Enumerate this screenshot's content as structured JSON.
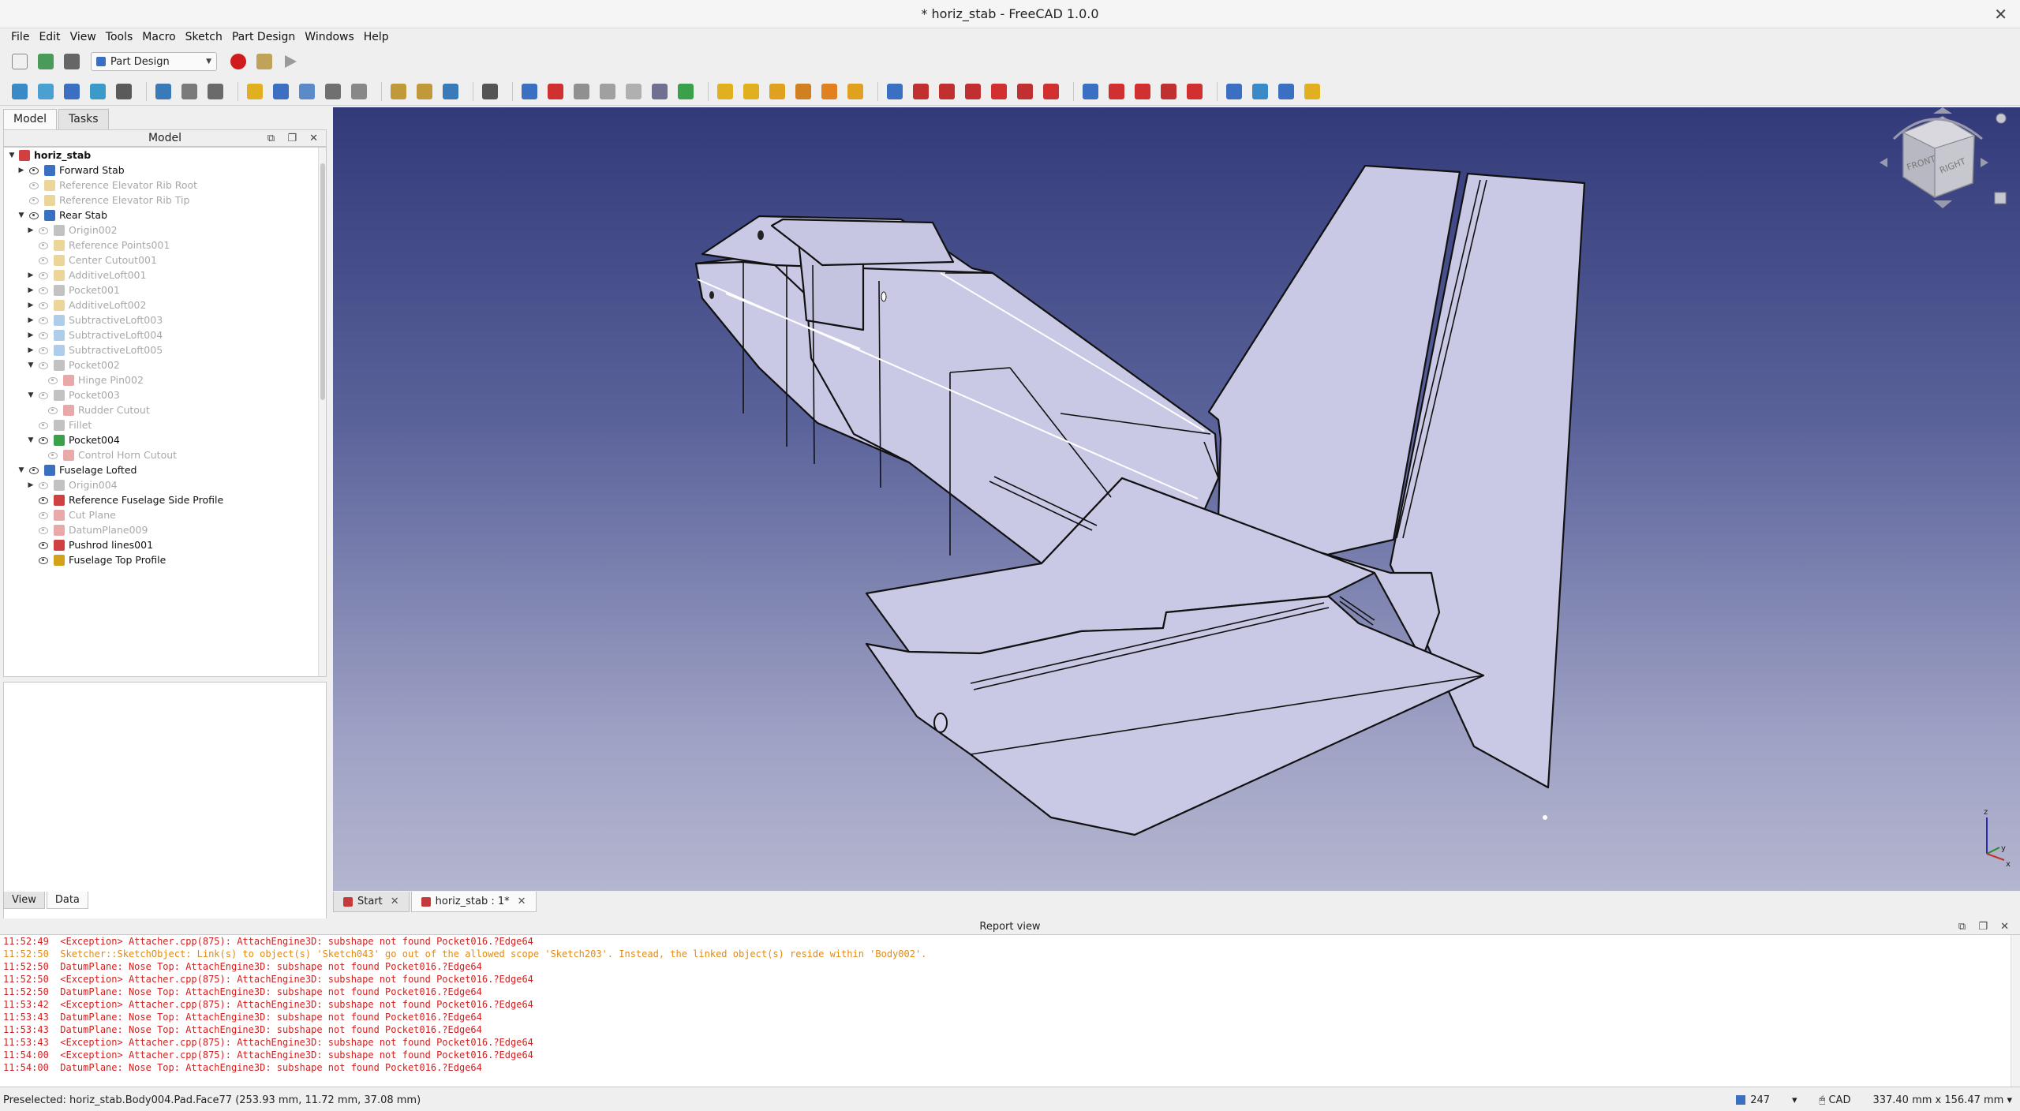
{
  "window": {
    "title": "* horiz_stab - FreeCAD 1.0.0"
  },
  "menu": [
    "File",
    "Edit",
    "View",
    "Tools",
    "Macro",
    "Sketch",
    "Part Design",
    "Windows",
    "Help"
  ],
  "workbench": {
    "selected": "Part Design"
  },
  "combo": {
    "tabs": [
      "Model",
      "Tasks"
    ],
    "tree_header": "Model",
    "property_tabs": [
      "View",
      "Data"
    ]
  },
  "tree": [
    {
      "label": "horiz_stab",
      "level": 0,
      "expand": "down",
      "eye": false,
      "state": "bold",
      "color": "#d04040"
    },
    {
      "label": "Forward Stab",
      "level": 1,
      "expand": "right",
      "eye": true,
      "state": "normal",
      "color": "#3a6fc2"
    },
    {
      "label": "Reference Elevator Rib Root",
      "level": 1,
      "expand": "",
      "eye": "hidden",
      "state": "dim",
      "color": "#d4a21a"
    },
    {
      "label": "Reference Elevator Rib Tip",
      "level": 1,
      "expand": "",
      "eye": "hidden",
      "state": "dim",
      "color": "#d4a21a"
    },
    {
      "label": "Rear Stab",
      "level": 1,
      "expand": "down",
      "eye": true,
      "state": "normal",
      "color": "#3a6fc2"
    },
    {
      "label": "Origin002",
      "level": 2,
      "expand": "right",
      "eye": "hidden",
      "state": "dim",
      "color": "#777777"
    },
    {
      "label": "Reference Points001",
      "level": 2,
      "expand": "",
      "eye": "hidden",
      "state": "dim",
      "color": "#d4a21a"
    },
    {
      "label": "Center Cutout001",
      "level": 2,
      "expand": "",
      "eye": "hidden",
      "state": "dim",
      "color": "#d4a21a"
    },
    {
      "label": "AdditiveLoft001",
      "level": 2,
      "expand": "right",
      "eye": "hidden",
      "state": "dim",
      "color": "#d4a21a"
    },
    {
      "label": "Pocket001",
      "level": 2,
      "expand": "right",
      "eye": "hidden",
      "state": "dim",
      "color": "#777777"
    },
    {
      "label": "AdditiveLoft002",
      "level": 2,
      "expand": "right",
      "eye": "hidden",
      "state": "dim",
      "color": "#d4a21a"
    },
    {
      "label": "SubtractiveLoft003",
      "level": 2,
      "expand": "right",
      "eye": "hidden",
      "state": "dim",
      "color": "#4a90d0"
    },
    {
      "label": "SubtractiveLoft004",
      "level": 2,
      "expand": "right",
      "eye": "hidden",
      "state": "dim",
      "color": "#4a90d0"
    },
    {
      "label": "SubtractiveLoft005",
      "level": 2,
      "expand": "right",
      "eye": "hidden",
      "state": "dim",
      "color": "#4a90d0"
    },
    {
      "label": "Pocket002",
      "level": 2,
      "expand": "down",
      "eye": "hidden",
      "state": "dim",
      "color": "#777777"
    },
    {
      "label": "Hinge Pin002",
      "level": 3,
      "expand": "",
      "eye": "hidden",
      "state": "dim",
      "color": "#d04040"
    },
    {
      "label": "Pocket003",
      "level": 2,
      "expand": "down",
      "eye": "hidden",
      "state": "dim",
      "color": "#777777"
    },
    {
      "label": "Rudder Cutout",
      "level": 3,
      "expand": "",
      "eye": "hidden",
      "state": "dim",
      "color": "#d04040"
    },
    {
      "label": "Fillet",
      "level": 2,
      "expand": "",
      "eye": "hidden",
      "state": "dim",
      "color": "#777777"
    },
    {
      "label": "Pocket004",
      "level": 2,
      "expand": "down",
      "eye": true,
      "state": "normal",
      "color": "#3aa04a"
    },
    {
      "label": "Control Horn Cutout",
      "level": 3,
      "expand": "",
      "eye": "hidden",
      "state": "dim",
      "color": "#d04040"
    },
    {
      "label": "Fuselage Lofted",
      "level": 1,
      "expand": "down",
      "eye": true,
      "state": "normal",
      "color": "#3a6fc2"
    },
    {
      "label": "Origin004",
      "level": 2,
      "expand": "right",
      "eye": "hidden",
      "state": "dim",
      "color": "#777777"
    },
    {
      "label": "Reference Fuselage Side Profile",
      "level": 2,
      "expand": "",
      "eye": true,
      "state": "normal",
      "color": "#d04040"
    },
    {
      "label": "Cut Plane",
      "level": 2,
      "expand": "",
      "eye": "hidden",
      "state": "dim",
      "color": "#d04040"
    },
    {
      "label": "DatumPlane009",
      "level": 2,
      "expand": "",
      "eye": "hidden",
      "state": "dim",
      "color": "#d04040"
    },
    {
      "label": "Pushrod lines001",
      "level": 2,
      "expand": "",
      "eye": true,
      "state": "normal",
      "color": "#d04040"
    },
    {
      "label": "Fuselage Top Profile",
      "level": 2,
      "expand": "",
      "eye": true,
      "state": "normal",
      "color": "#d4a21a"
    }
  ],
  "doc_tabs": [
    "Start",
    "horiz_stab : 1*"
  ],
  "report": {
    "title": "Report view",
    "lines": [
      {
        "text": "11:52:49  <Exception> Attacher.cpp(875): AttachEngine3D: subshape not found Pocket016.?Edge64",
        "kind": "error"
      },
      {
        "text": "11:52:50  Sketcher::SketchObject: Link(s) to object(s) 'Sketch043' go out of the allowed scope 'Sketch203'. Instead, the linked object(s) reside within 'Body002'.",
        "kind": "warn"
      },
      {
        "text": "11:52:50  DatumPlane: Nose Top: AttachEngine3D: subshape not found Pocket016.?Edge64",
        "kind": "error"
      },
      {
        "text": "11:52:50  <Exception> Attacher.cpp(875): AttachEngine3D: subshape not found Pocket016.?Edge64",
        "kind": "error"
      },
      {
        "text": "11:52:50  DatumPlane: Nose Top: AttachEngine3D: subshape not found Pocket016.?Edge64",
        "kind": "error"
      },
      {
        "text": "11:53:42  <Exception> Attacher.cpp(875): AttachEngine3D: subshape not found Pocket016.?Edge64",
        "kind": "error"
      },
      {
        "text": "11:53:43  DatumPlane: Nose Top: AttachEngine3D: subshape not found Pocket016.?Edge64",
        "kind": "error"
      },
      {
        "text": "11:53:43  DatumPlane: Nose Top: AttachEngine3D: subshape not found Pocket016.?Edge64",
        "kind": "error"
      },
      {
        "text": "11:53:43  <Exception> Attacher.cpp(875): AttachEngine3D: subshape not found Pocket016.?Edge64",
        "kind": "error"
      },
      {
        "text": "11:54:00  <Exception> Attacher.cpp(875): AttachEngine3D: subshape not found Pocket016.?Edge64",
        "kind": "error"
      },
      {
        "text": "11:54:00  DatumPlane: Nose Top: AttachEngine3D: subshape not found Pocket016.?Edge64",
        "kind": "error"
      }
    ]
  },
  "status": {
    "message": "Preselected: horiz_stab.Body004.Pad.Face77 (253.93 mm, 11.72 mm, 37.08 mm)",
    "count": "247",
    "nav_style": "CAD",
    "dimensions": "337.40 mm x 156.47 mm"
  },
  "navcube": {
    "face_labels": [
      "FRONT",
      "RIGHT"
    ]
  },
  "colors": {
    "model_face": "#c9c9e6",
    "view_top": "#323a7a",
    "view_bottom": "#b4b6cf",
    "error_text": "#d21f1f",
    "warn_text": "#e08a14"
  },
  "toolbar_icons": {
    "row1": [
      "new-file-icon",
      "open-file-icon",
      "save-file-icon",
      "record-macro-icon",
      "macro-editor-icon",
      "run-macro-icon"
    ],
    "row2": [
      "fit-all-icon",
      "fit-selection-icon",
      "view-isometric-icon",
      "view-front-icon",
      "draw-style-icon",
      "std-views-icon",
      "measure-icon",
      "workbench-icon",
      "create-body-icon",
      "create-part-icon",
      "create-group-icon",
      "link-icon",
      "variable-set-icon",
      "undo-icon",
      "redo-icon",
      "refresh-icon",
      "whats-this-icon",
      "body-icon",
      "sketch-icon",
      "validate-sketch-icon",
      "datum-point-icon",
      "datum-line-icon",
      "datum-plane-icon",
      "shape-binder-icon",
      "pad-icon",
      "revolve-icon",
      "additive-loft-icon",
      "additive-pipe-icon",
      "additive-helix-icon",
      "additive-primitive-icon",
      "pocket-icon",
      "hole-icon",
      "groove-icon",
      "subtractive-loft-icon",
      "subtractive-pipe-icon",
      "subtractive-helix-icon",
      "subtractive-primitive-icon",
      "boolean-icon",
      "fillet-icon",
      "chamfer-icon",
      "draft-icon",
      "thickness-icon",
      "mirror-icon",
      "linear-pattern-icon",
      "polar-pattern-icon",
      "multi-transform-icon"
    ]
  }
}
